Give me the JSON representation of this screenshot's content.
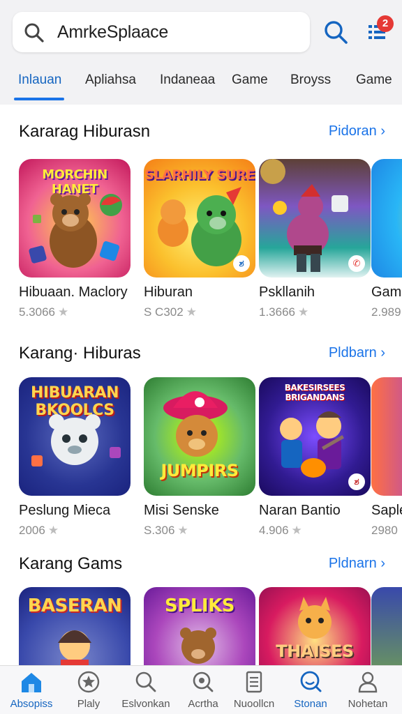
{
  "search": {
    "value": "AmrkeSplaace"
  },
  "header": {
    "notification_count": "2"
  },
  "tabs": [
    {
      "label": "Inlauan"
    },
    {
      "label": "Apliahsa"
    },
    {
      "label": "Indaneaa"
    },
    {
      "label": "Game"
    },
    {
      "label": "Broyss"
    },
    {
      "label": "Game"
    }
  ],
  "sections": [
    {
      "title": "Kararag Hiburasn",
      "more": "Pidoran",
      "cards": [
        {
          "name": "Hibuaan. Maclory",
          "rating": "5.3066",
          "art": "MORCHIN HANET"
        },
        {
          "name": "Hiburan",
          "rating": "S C302",
          "art": "SLARHILY SURE"
        },
        {
          "name": "Pskllanih",
          "rating": "1.3666",
          "art": ""
        },
        {
          "name": "Gama",
          "rating": "2.989",
          "art": ""
        }
      ]
    },
    {
      "title": "Karang· Hiburas",
      "more": "Pldbarn",
      "cards": [
        {
          "name": "Peslung Mieca",
          "rating": "2006",
          "art": "HIBUARAN BKOOLCS"
        },
        {
          "name": "Misi Senske",
          "rating": "S.306",
          "art": "JUMPIRS"
        },
        {
          "name": "Naran Bantio",
          "rating": "4.906",
          "art": "BAKESIRSEES BRIGANDANS"
        },
        {
          "name": "Saple",
          "rating": "2980",
          "art": ""
        }
      ]
    },
    {
      "title": "Karang Gams",
      "more": "Pldnarn",
      "cards": [
        {
          "name": "",
          "rating": "",
          "art": "BASERAN"
        },
        {
          "name": "",
          "rating": "",
          "art": "SPLIKS"
        },
        {
          "name": "",
          "rating": "",
          "art": "THAISES"
        },
        {
          "name": "",
          "rating": "",
          "art": ""
        }
      ]
    }
  ],
  "bottom_nav": [
    {
      "label": "Absopiss",
      "icon": "home-icon"
    },
    {
      "label": "Plaly",
      "icon": "star-badge-icon"
    },
    {
      "label": "Eslvonkan",
      "icon": "search-icon"
    },
    {
      "label": "Acrtha",
      "icon": "search-target-icon"
    },
    {
      "label": "Nuoollcn",
      "icon": "document-icon"
    },
    {
      "label": "Stonan",
      "icon": "smile-search-icon"
    },
    {
      "label": "Nohetan",
      "icon": "user-icon"
    }
  ],
  "colors": {
    "accent": "#1a73e8",
    "badge": "#e53935"
  }
}
